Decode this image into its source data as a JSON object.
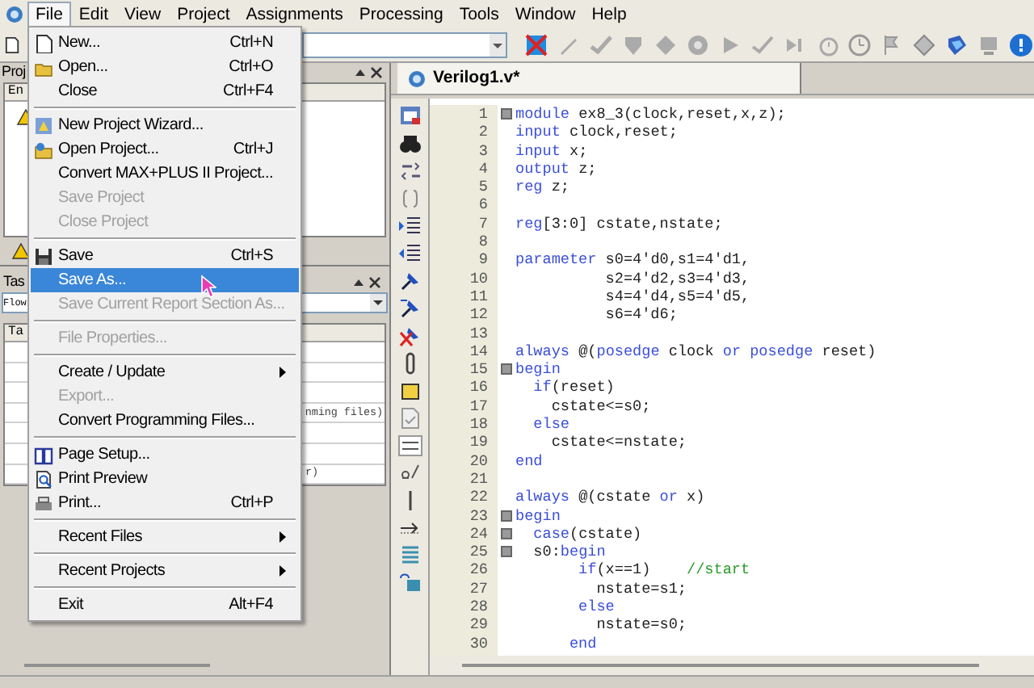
{
  "menu_bar": [
    {
      "label": "File",
      "selected": true
    },
    {
      "label": "Edit",
      "selected": false
    },
    {
      "label": "View",
      "selected": false
    },
    {
      "label": "Project",
      "selected": false
    },
    {
      "label": "Assignments",
      "selected": false
    },
    {
      "label": "Processing",
      "selected": false
    },
    {
      "label": "Tools",
      "selected": false
    },
    {
      "label": "Window",
      "selected": false
    },
    {
      "label": "Help",
      "selected": false
    }
  ],
  "file_menu": [
    {
      "kind": "item",
      "label": "New...",
      "shortcut": "Ctrl+N",
      "disabled": false,
      "selected": false
    },
    {
      "kind": "item",
      "label": "Open...",
      "shortcut": "Ctrl+O",
      "disabled": false,
      "selected": false
    },
    {
      "kind": "item",
      "label": "Close",
      "shortcut": "Ctrl+F4",
      "disabled": false,
      "selected": false
    },
    {
      "kind": "separator"
    },
    {
      "kind": "item",
      "label": "New Project Wizard...",
      "disabled": false,
      "selected": false
    },
    {
      "kind": "item",
      "label": "Open Project...",
      "shortcut": "Ctrl+J",
      "disabled": false,
      "selected": false
    },
    {
      "kind": "item",
      "label": "Convert MAX+PLUS II Project...",
      "disabled": false,
      "selected": false
    },
    {
      "kind": "item",
      "label": "Save Project",
      "disabled": true,
      "selected": false
    },
    {
      "kind": "item",
      "label": "Close Project",
      "disabled": true,
      "selected": false
    },
    {
      "kind": "separator"
    },
    {
      "kind": "item",
      "label": "Save",
      "shortcut": "Ctrl+S",
      "disabled": false,
      "selected": false
    },
    {
      "kind": "item",
      "label": "Save As...",
      "disabled": false,
      "selected": true
    },
    {
      "kind": "item",
      "label": "Save Current Report Section As...",
      "disabled": true,
      "selected": false
    },
    {
      "kind": "separator"
    },
    {
      "kind": "item",
      "label": "File Properties...",
      "disabled": true,
      "selected": false
    },
    {
      "kind": "separator"
    },
    {
      "kind": "submenu",
      "label": "Create / Update",
      "disabled": false,
      "selected": false
    },
    {
      "kind": "item",
      "label": "Export...",
      "disabled": true,
      "selected": false
    },
    {
      "kind": "item",
      "label": "Convert Programming Files...",
      "disabled": false,
      "selected": false
    },
    {
      "kind": "separator"
    },
    {
      "kind": "item",
      "label": "Page Setup...",
      "disabled": false,
      "selected": false
    },
    {
      "kind": "item",
      "label": "Print Preview",
      "disabled": false,
      "selected": false
    },
    {
      "kind": "item",
      "label": "Print...",
      "shortcut": "Ctrl+P",
      "disabled": false,
      "selected": false
    },
    {
      "kind": "separator"
    },
    {
      "kind": "submenu",
      "label": "Recent Files",
      "disabled": false,
      "selected": false
    },
    {
      "kind": "separator"
    },
    {
      "kind": "submenu",
      "label": "Recent Projects",
      "disabled": false,
      "selected": false
    },
    {
      "kind": "separator"
    },
    {
      "kind": "item",
      "label": "Exit",
      "shortcut": "Alt+F4",
      "disabled": false,
      "selected": false
    }
  ],
  "project_panel": {
    "title": "Proj",
    "column_1": "En"
  },
  "tasks_panel": {
    "title": "Tas",
    "flow_field": {
      "value": "Flow"
    },
    "column_1": "Ta",
    "rows": [
      {},
      {},
      {},
      {
        "column_2": "nming files)"
      },
      {},
      {},
      {
        "column_2": "r)"
      }
    ]
  },
  "editor": {
    "tab": {
      "label": "Verilog1.v*",
      "selected": true
    },
    "lines": [
      {
        "number": "1",
        "fold": true,
        "tokens": [
          {
            "kind": "keyword",
            "text": "module"
          },
          {
            "kind": "plain",
            "text": " ex8_3(clock,reset,x,z);"
          }
        ]
      },
      {
        "number": "2",
        "fold": false,
        "tokens": [
          {
            "kind": "keyword",
            "text": "input"
          },
          {
            "kind": "plain",
            "text": " clock,reset;"
          }
        ]
      },
      {
        "number": "3",
        "fold": false,
        "tokens": [
          {
            "kind": "keyword",
            "text": "input"
          },
          {
            "kind": "plain",
            "text": " x;"
          }
        ]
      },
      {
        "number": "4",
        "fold": false,
        "tokens": [
          {
            "kind": "keyword",
            "text": "output"
          },
          {
            "kind": "plain",
            "text": " z;"
          }
        ]
      },
      {
        "number": "5",
        "fold": false,
        "tokens": [
          {
            "kind": "keyword",
            "text": "reg"
          },
          {
            "kind": "plain",
            "text": " z;"
          }
        ]
      },
      {
        "number": "6",
        "fold": false
      },
      {
        "number": "7",
        "fold": false,
        "tokens": [
          {
            "kind": "keyword",
            "text": "reg"
          },
          {
            "kind": "plain",
            "text": "[3:0] cstate,nstate;"
          }
        ]
      },
      {
        "number": "8",
        "fold": false
      },
      {
        "number": "9",
        "fold": false,
        "tokens": [
          {
            "kind": "keyword",
            "text": "parameter"
          },
          {
            "kind": "plain",
            "text": " s0=4'd0,s1=4'd1,"
          }
        ]
      },
      {
        "number": "10",
        "fold": false,
        "tokens": [
          {
            "kind": "plain",
            "text": "          s2=4'd2,s3=4'd3,"
          }
        ]
      },
      {
        "number": "11",
        "fold": false,
        "tokens": [
          {
            "kind": "plain",
            "text": "          s4=4'd4,s5=4'd5,"
          }
        ]
      },
      {
        "number": "12",
        "fold": false,
        "tokens": [
          {
            "kind": "plain",
            "text": "          s6=4'd6;"
          }
        ]
      },
      {
        "number": "13",
        "fold": false
      },
      {
        "number": "14",
        "fold": false,
        "tokens": [
          {
            "kind": "keyword",
            "text": "always"
          },
          {
            "kind": "plain",
            "text": " @("
          },
          {
            "kind": "keyword",
            "text": "posedge"
          },
          {
            "kind": "plain",
            "text": " clock "
          },
          {
            "kind": "keyword",
            "text": "or posedge"
          },
          {
            "kind": "plain",
            "text": " reset)"
          }
        ]
      },
      {
        "number": "15",
        "fold": true,
        "tokens": [
          {
            "kind": "keyword",
            "text": "begin"
          }
        ]
      },
      {
        "number": "16",
        "fold": false,
        "tokens": [
          {
            "kind": "keyword",
            "text": "  if"
          },
          {
            "kind": "plain",
            "text": "(reset)"
          }
        ]
      },
      {
        "number": "17",
        "fold": false,
        "tokens": [
          {
            "kind": "plain",
            "text": "    cstate<=s0;"
          }
        ]
      },
      {
        "number": "18",
        "fold": false,
        "tokens": [
          {
            "kind": "keyword",
            "text": "  else"
          }
        ]
      },
      {
        "number": "19",
        "fold": false,
        "tokens": [
          {
            "kind": "plain",
            "text": "    cstate<=nstate;"
          }
        ]
      },
      {
        "number": "20",
        "fold": false,
        "tokens": [
          {
            "kind": "keyword",
            "text": "end"
          }
        ]
      },
      {
        "number": "21",
        "fold": false
      },
      {
        "number": "22",
        "fold": false,
        "tokens": [
          {
            "kind": "keyword",
            "text": "always"
          },
          {
            "kind": "plain",
            "text": " @(cstate "
          },
          {
            "kind": "keyword",
            "text": "or"
          },
          {
            "kind": "plain",
            "text": " x)"
          }
        ]
      },
      {
        "number": "23",
        "fold": true,
        "tokens": [
          {
            "kind": "keyword",
            "text": "begin"
          }
        ]
      },
      {
        "number": "24",
        "fold": true,
        "tokens": [
          {
            "kind": "keyword",
            "text": "  case"
          },
          {
            "kind": "plain",
            "text": "(cstate)"
          }
        ]
      },
      {
        "number": "25",
        "fold": true,
        "tokens": [
          {
            "kind": "plain",
            "text": "  s0:"
          },
          {
            "kind": "keyword",
            "text": "begin"
          }
        ]
      },
      {
        "number": "26",
        "fold": false,
        "tokens": [
          {
            "kind": "keyword",
            "text": "       if"
          },
          {
            "kind": "plain",
            "text": "(x==1)    "
          },
          {
            "kind": "comment",
            "text": "//start"
          }
        ]
      },
      {
        "number": "27",
        "fold": false,
        "tokens": [
          {
            "kind": "plain",
            "text": "         nstate=s1;"
          }
        ]
      },
      {
        "number": "28",
        "fold": false,
        "tokens": [
          {
            "kind": "keyword",
            "text": "       else"
          }
        ]
      },
      {
        "number": "29",
        "fold": false,
        "tokens": [
          {
            "kind": "plain",
            "text": "         nstate=s0;"
          }
        ]
      },
      {
        "number": "30",
        "fold": false,
        "tokens": [
          {
            "kind": "keyword",
            "text": "      end"
          }
        ]
      }
    ]
  }
}
